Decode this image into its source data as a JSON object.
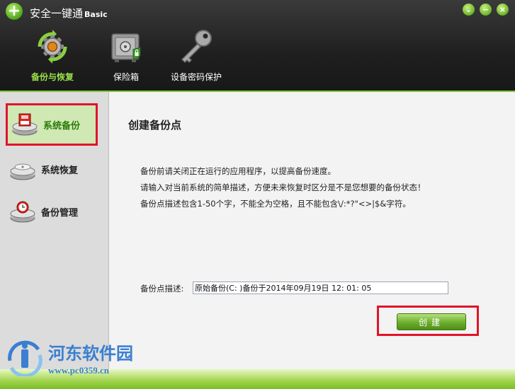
{
  "window": {
    "title": "安全一键通",
    "edition": "Basic",
    "controls": {
      "collapse": "⌄",
      "minimize": "−",
      "close": "×"
    }
  },
  "nav": {
    "tabs": [
      {
        "label": "备份与恢复",
        "icon": "gear-icon",
        "active": true
      },
      {
        "label": "保险箱",
        "icon": "safe-icon",
        "active": false
      },
      {
        "label": "设备密码保护",
        "icon": "key-icon",
        "active": false
      }
    ]
  },
  "sidebar": {
    "items": [
      {
        "label": "系统备份",
        "icon": "disk-backup-icon",
        "active": true
      },
      {
        "label": "系统恢复",
        "icon": "disk-restore-icon",
        "active": false
      },
      {
        "label": "备份管理",
        "icon": "disk-manage-icon",
        "active": false
      }
    ]
  },
  "main": {
    "title": "创建备份点",
    "notes": [
      "备份前请关闭正在运行的应用程序，以提高备份速度。",
      "请输入对当前系统的简单描述，方便未来恢复时区分是不是您想要的备份状态！",
      "备份点描述包含1-50个字，不能全为空格，且不能包含\\/:*?\"<>|$&字符。"
    ],
    "desc_label": "备份点描述:",
    "desc_value": "原始备份(C: )备份于2014年09月19日 12: 01: 05",
    "create_label": "创建"
  },
  "watermark": {
    "name": "河东软件园",
    "url": "www.pc0359.cn"
  },
  "colors": {
    "accent": "#7cc63a",
    "highlight": "#e0142a",
    "header_bg": "#1f1f1f",
    "watermark": "#3a7fd0"
  }
}
